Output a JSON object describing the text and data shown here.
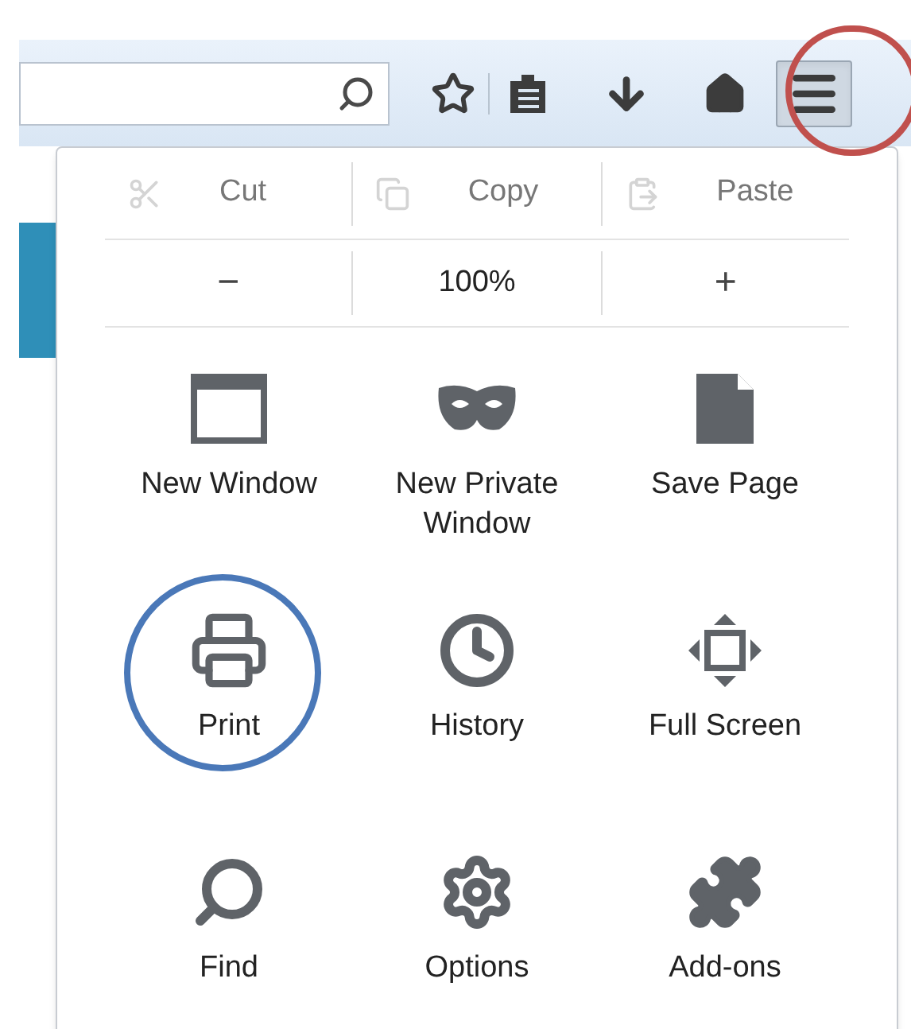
{
  "toolbar": {
    "menu_button": {
      "highlighted": true
    }
  },
  "edit_row": [
    {
      "label": "Cut",
      "kind": "cut",
      "disabled": true
    },
    {
      "label": "Copy",
      "kind": "copy",
      "disabled": true
    },
    {
      "label": "Paste",
      "kind": "paste",
      "disabled": true
    }
  ],
  "zoom_row": {
    "decrease": "−",
    "level": "100%",
    "increase": "+"
  },
  "items": [
    {
      "label": "New Window",
      "kind": "window",
      "highlighted": false
    },
    {
      "label": "New Private Window",
      "kind": "mask",
      "highlighted": false
    },
    {
      "label": "Save Page",
      "kind": "page",
      "highlighted": false
    },
    {
      "label": "Print",
      "kind": "printer",
      "highlighted": true
    },
    {
      "label": "History",
      "kind": "clock",
      "highlighted": false
    },
    {
      "label": "Full Screen",
      "kind": "fullscreen",
      "highlighted": false
    },
    {
      "label": "Find",
      "kind": "magnifier",
      "highlighted": false
    },
    {
      "label": "Options",
      "kind": "gear",
      "highlighted": false
    },
    {
      "label": "Add-ons",
      "kind": "puzzle",
      "highlighted": false
    }
  ]
}
